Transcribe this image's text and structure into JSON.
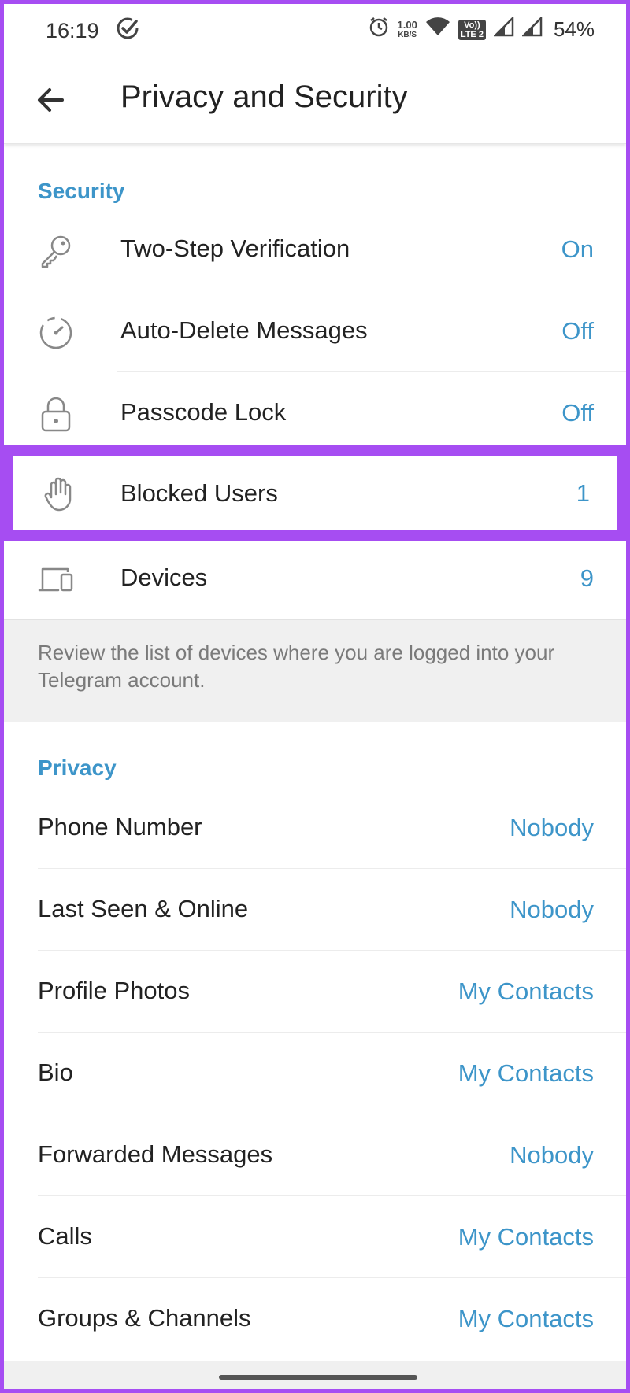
{
  "status_bar": {
    "time": "16:19",
    "net_speed_value": "1.00",
    "net_speed_unit": "KB/S",
    "volte_top": "Vo))",
    "volte_bottom": "LTE 2",
    "battery": "54%"
  },
  "app_bar": {
    "title": "Privacy and Security"
  },
  "security": {
    "header": "Security",
    "items": [
      {
        "label": "Two-Step Verification",
        "value": "On",
        "icon": "key-icon"
      },
      {
        "label": "Auto-Delete Messages",
        "value": "Off",
        "icon": "timer-icon"
      },
      {
        "label": "Passcode Lock",
        "value": "Off",
        "icon": "lock-icon"
      },
      {
        "label": "Blocked Users",
        "value": "1",
        "icon": "hand-icon"
      },
      {
        "label": "Devices",
        "value": "9",
        "icon": "devices-icon"
      }
    ],
    "info": "Review the list of devices where you are logged into your Telegram account."
  },
  "privacy": {
    "header": "Privacy",
    "items": [
      {
        "label": "Phone Number",
        "value": "Nobody"
      },
      {
        "label": "Last Seen & Online",
        "value": "Nobody"
      },
      {
        "label": "Profile Photos",
        "value": "My Contacts"
      },
      {
        "label": "Bio",
        "value": "My Contacts"
      },
      {
        "label": "Forwarded Messages",
        "value": "Nobody"
      },
      {
        "label": "Calls",
        "value": "My Contacts"
      },
      {
        "label": "Groups & Channels",
        "value": "My Contacts"
      }
    ]
  },
  "colors": {
    "accent": "#3d95c9",
    "highlight": "#a64df2",
    "text": "#222222",
    "muted": "#7a7a7a"
  }
}
